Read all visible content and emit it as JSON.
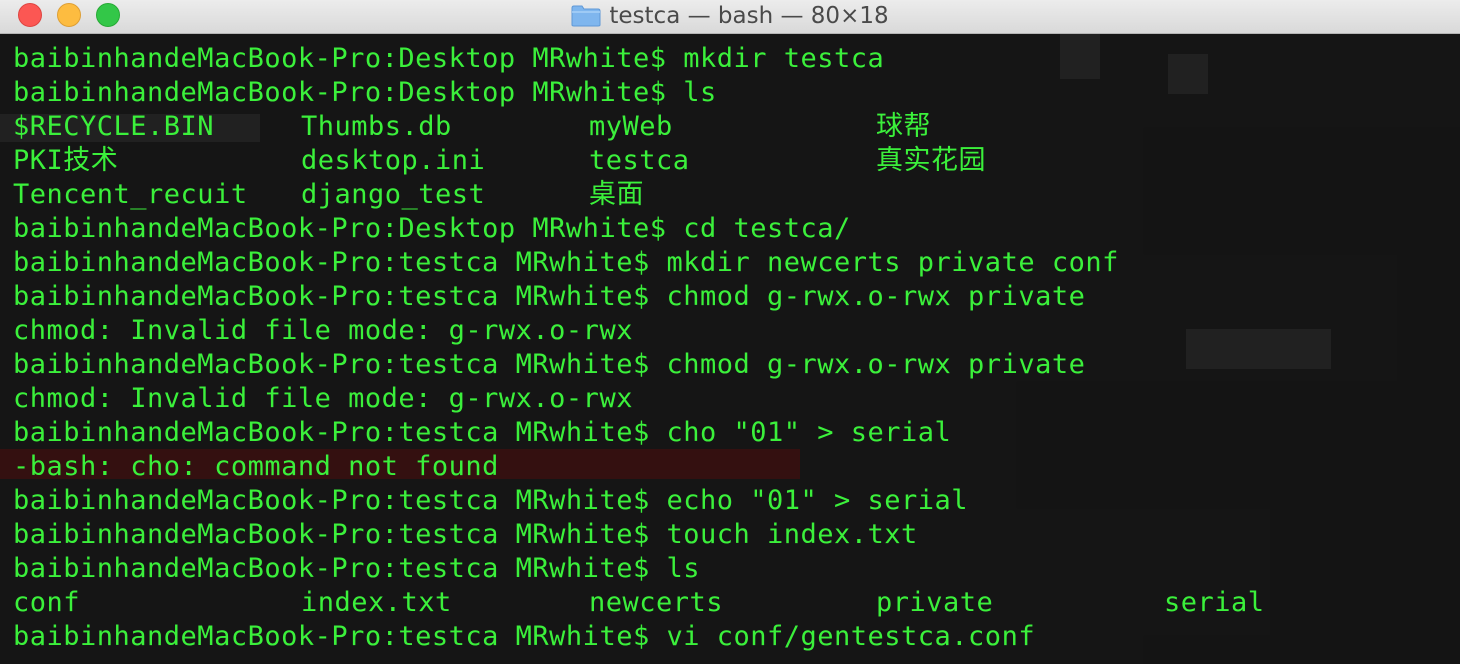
{
  "window": {
    "title": "testca — bash — 80×18"
  },
  "terminal": {
    "lines": [
      "baibinhandeMacBook-Pro:Desktop MRwhite$ mkdir testca",
      "baibinhandeMacBook-Pro:Desktop MRwhite$ ls"
    ],
    "ls1": [
      [
        "$RECYCLE.BIN",
        "Thumbs.db",
        "myWeb",
        "球帮"
      ],
      [
        "PKI技术",
        "desktop.ini",
        "testca",
        "真实花园"
      ],
      [
        "Tencent_recuit",
        "django_test",
        "桌面",
        ""
      ]
    ],
    "lines2": [
      "baibinhandeMacBook-Pro:Desktop MRwhite$ cd testca/",
      "baibinhandeMacBook-Pro:testca MRwhite$ mkdir newcerts private conf",
      "baibinhandeMacBook-Pro:testca MRwhite$ chmod g-rwx.o-rwx private",
      "chmod: Invalid file mode: g-rwx.o-rwx",
      "baibinhandeMacBook-Pro:testca MRwhite$ chmod g-rwx.o-rwx private",
      "chmod: Invalid file mode: g-rwx.o-rwx",
      "baibinhandeMacBook-Pro:testca MRwhite$ cho \"01\" > serial",
      "-bash: cho: command not found",
      "baibinhandeMacBook-Pro:testca MRwhite$ echo \"01\" > serial",
      "baibinhandeMacBook-Pro:testca MRwhite$ touch index.txt",
      "baibinhandeMacBook-Pro:testca MRwhite$ ls"
    ],
    "ls2": [
      "conf",
      "index.txt",
      "newcerts",
      "private",
      "serial"
    ],
    "last_line": "baibinhandeMacBook-Pro:testca MRwhite$ vi conf/gentestca.conf"
  },
  "colors": {
    "text": "#3bf03b",
    "background": "#141414"
  }
}
